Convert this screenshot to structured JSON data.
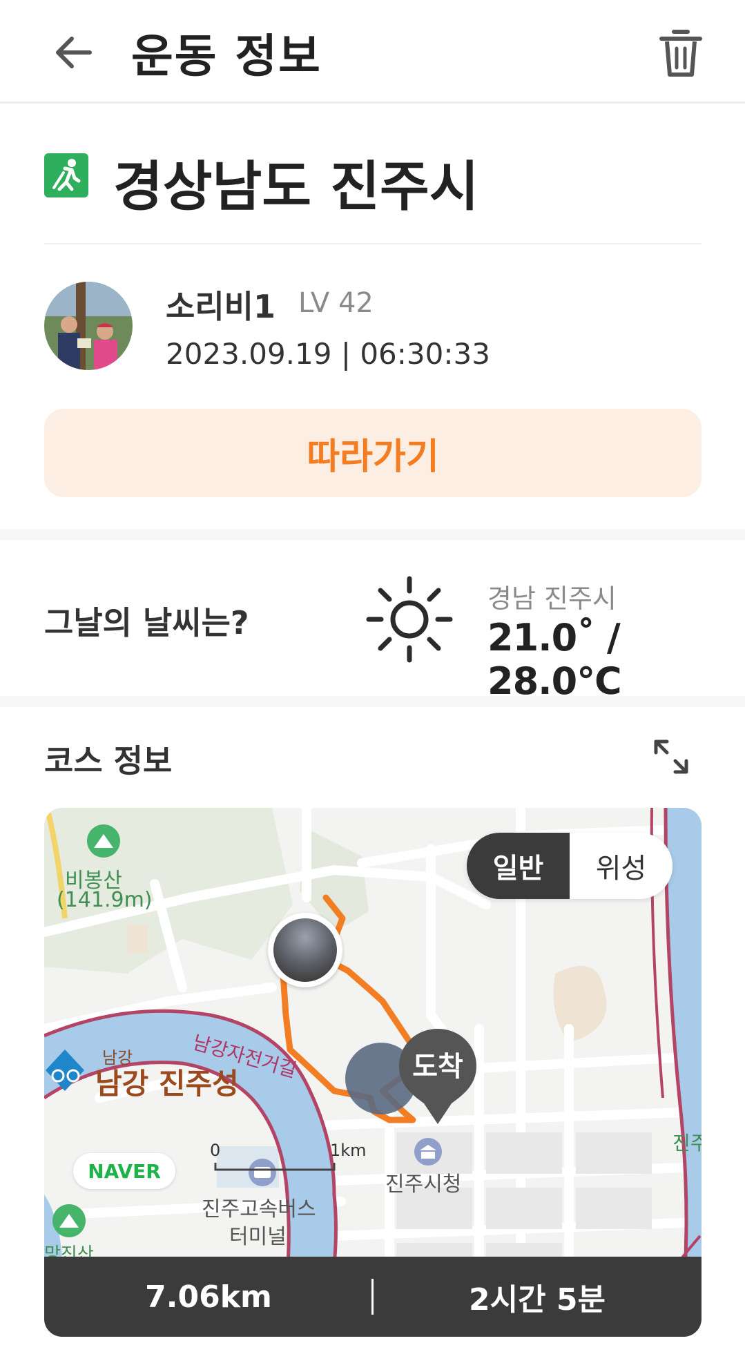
{
  "header": {
    "title": "운동 정보",
    "back_icon": "back-arrow-icon",
    "delete_icon": "trash-icon"
  },
  "location": {
    "icon": "hiking-icon",
    "title": "경상남도 진주시"
  },
  "user": {
    "name": "소리비1",
    "level": "LV 42",
    "datetime": "2023.09.19 | 06:30:33"
  },
  "follow_button": "따라가기",
  "weather": {
    "label": "그날의 날씨는?",
    "icon": "sun-icon",
    "region": "경남 진주시",
    "temperature": "21.0˚ / 28.0℃"
  },
  "course": {
    "label": "코스 정보",
    "expand_icon": "expand-icon",
    "map": {
      "toggle": {
        "normal": "일반",
        "satellite": "위성",
        "selected": "일반"
      },
      "labels": {
        "mountain_name": "비봉산",
        "mountain_height": "(141.9m)",
        "river_small": "남강",
        "castle": "남강 진주성",
        "bike_road": "남강자전거길",
        "city_hall": "진주시청",
        "bus_terminal_1": "진주고속버스",
        "bus_terminal_2": "터미널",
        "scale_start": "0",
        "scale_end": "1km",
        "bottom_left_peak": "망진산",
        "right_edge": "진주"
      },
      "provider": "NAVER",
      "arrive_marker": "도착",
      "route_color": "#f27d22"
    },
    "distance": "7.06km",
    "duration": "2시간 5분"
  },
  "colors": {
    "accent": "#f27d22",
    "accent_bg": "#fdeee3",
    "dark": "#3b3b3b"
  }
}
